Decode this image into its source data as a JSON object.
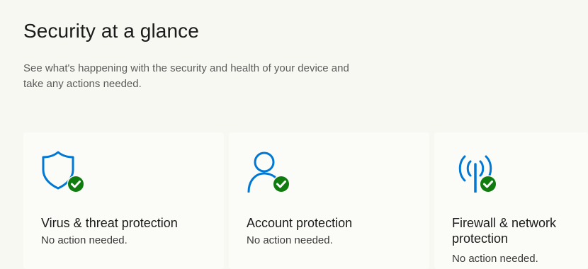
{
  "header": {
    "title": "Security at a glance",
    "subtitle": "See what's happening with the security and health of your device and take any actions needed."
  },
  "cards": [
    {
      "title": "Virus & threat protection",
      "status": "No action needed.",
      "icon": "shield-icon"
    },
    {
      "title": "Account protection",
      "status": "No action needed.",
      "icon": "person-icon"
    },
    {
      "title": "Firewall & network protection",
      "status": "No action needed.",
      "icon": "antenna-icon"
    }
  ],
  "colors": {
    "accent": "#0078d4",
    "success": "#107c10",
    "background": "#f8f8f3"
  }
}
